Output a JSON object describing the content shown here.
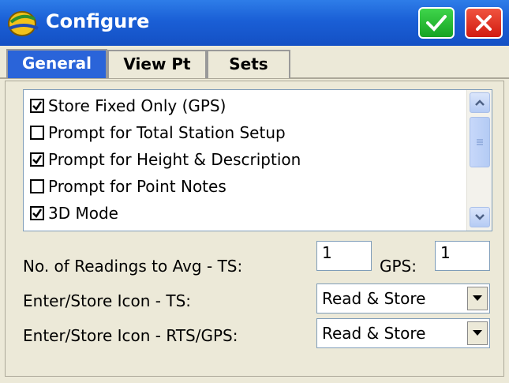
{
  "window": {
    "title": "Configure",
    "ok_icon": "check-icon",
    "close_icon": "close-icon",
    "accent": "#1a5fd6",
    "ok_color": "#1fae2b",
    "close_color": "#e02a1a"
  },
  "tabs": [
    {
      "label": "General",
      "active": true
    },
    {
      "label": "View Pt",
      "active": false
    },
    {
      "label": "Sets",
      "active": false
    }
  ],
  "options": [
    {
      "label": "Store Fixed Only (GPS)",
      "checked": true
    },
    {
      "label": "Prompt for Total Station Setup",
      "checked": false
    },
    {
      "label": "Prompt for Height & Description",
      "checked": true
    },
    {
      "label": "Prompt for Point Notes",
      "checked": false
    },
    {
      "label": "3D Mode",
      "checked": true
    }
  ],
  "readings": {
    "label": "No. of Readings to Avg  -  TS:",
    "ts_value": "1",
    "gps_label": "GPS:",
    "gps_value": "1"
  },
  "store_icon_ts": {
    "label": "Enter/Store Icon - TS:",
    "value": "Read & Store"
  },
  "store_icon_rts": {
    "label": "Enter/Store Icon - RTS/GPS:",
    "value": "Read & Store"
  }
}
